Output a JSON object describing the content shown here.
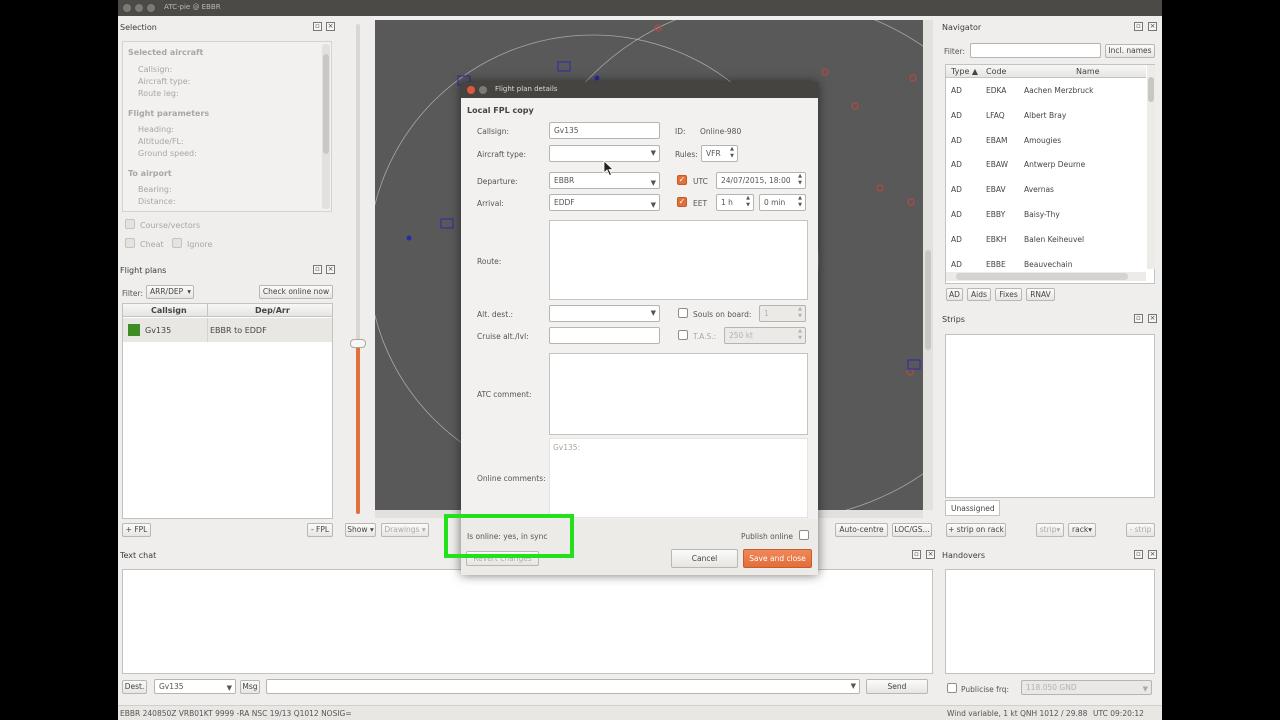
{
  "window": {
    "title": "ATC-pie @ EBBR"
  },
  "selection": {
    "title": "Selection",
    "selected_aircraft": "Selected aircraft",
    "callsign": "Callsign:",
    "aircraft_type": "Aircraft type:",
    "route_leg": "Route leg:",
    "flight_parameters": "Flight parameters",
    "heading": "Heading:",
    "altitude": "Altitude/FL:",
    "ground_speed": "Ground speed:",
    "to_airport": "To airport",
    "bearing": "Bearing:",
    "distance": "Distance:",
    "course_vectors": "Course/vectors",
    "cheat": "Cheat",
    "ignore": "Ignore"
  },
  "flight_plans": {
    "title": "Flight plans",
    "filter_label": "Filter:",
    "filter_value": "ARR/DEP",
    "check_online": "Check online now",
    "col_callsign": "Callsign",
    "col_deparr": "Dep/Arr",
    "rows": [
      {
        "callsign": "Gv135",
        "deparr": "EBBR to EDDF",
        "color": "#3f8b25"
      }
    ],
    "add_fpl": "+ FPL",
    "remove_fpl": "- FPL"
  },
  "radar_toolbar": {
    "show": "Show",
    "drawings": "Drawings",
    "auto_centre": "Auto-centre",
    "loc_gs": "LOC/GS..."
  },
  "navigator": {
    "title": "Navigator",
    "filter_label": "Filter:",
    "incl_names": "Incl. names",
    "col_type": "Type",
    "col_code": "Code",
    "col_name": "Name",
    "rows": [
      {
        "type": "AD",
        "code": "EDKA",
        "name": "Aachen Merzbruck"
      },
      {
        "type": "AD",
        "code": "LFAQ",
        "name": "Albert Bray"
      },
      {
        "type": "AD",
        "code": "EBAM",
        "name": "Amougies"
      },
      {
        "type": "AD",
        "code": "EBAW",
        "name": "Antwerp Deurne"
      },
      {
        "type": "AD",
        "code": "EBAV",
        "name": "Avernas"
      },
      {
        "type": "AD",
        "code": "EBBY",
        "name": "Baisy-Thy"
      },
      {
        "type": "AD",
        "code": "EBKH",
        "name": "Balen Keiheuvel"
      },
      {
        "type": "AD",
        "code": "EBBE",
        "name": "Beauvechain"
      }
    ],
    "tabs": [
      "AD",
      "Aids",
      "Fixes",
      "RNAV"
    ]
  },
  "strips": {
    "title": "Strips",
    "unassigned": "Unassigned",
    "strip_on_rack": "+ strip on rack",
    "strip": "strip",
    "rack": "rack",
    "remove_strip": "- strip"
  },
  "text_chat": {
    "title": "Text chat",
    "dest_label": "Dest.",
    "dest_value": "Gv135",
    "msg_label": "Msg",
    "send": "Send"
  },
  "handovers": {
    "title": "Handovers",
    "publicise_frq": "Publicise frq:",
    "frq_value": "118.050  GND"
  },
  "status_bar": {
    "metar": "EBBR 240850Z VRB01KT 9999 -RA NSC 19/13 Q1012 NOSIG=",
    "wind": "Wind variable, 1 kt",
    "qnh": "QNH 1012 / 29.88",
    "utc": "UTC 09:20:12"
  },
  "dialog": {
    "title": "Flight plan details",
    "section": "Local FPL copy",
    "callsign_label": "Callsign:",
    "callsign_value": "Gv135",
    "id_label": "ID:",
    "id_value": "Online-980",
    "aircraft_type_label": "Aircraft type:",
    "rules_label": "Rules:",
    "rules_value": "VFR",
    "departure_label": "Departure:",
    "departure_value": "EBBR",
    "utc_label": "UTC",
    "utc_value": "24/07/2015, 18:00",
    "arrival_label": "Arrival:",
    "arrival_value": "EDDF",
    "eet_label": "EET",
    "eet_hours": "1 h",
    "eet_minutes": "0 min",
    "route_label": "Route:",
    "alt_dest_label": "Alt. dest.:",
    "souls_label": "Souls on board:",
    "souls_value": "1",
    "cruise_label": "Cruise alt./lvl:",
    "tas_label": "T.A.S.:",
    "tas_value": "250 kt",
    "atc_comment_label": "ATC comment:",
    "online_comments_label": "Online comments:",
    "online_comments_value": "Gv135:",
    "is_online": "Is online: yes, in sync",
    "publish_online": "Publish online",
    "revert": "Revert changes",
    "cancel": "Cancel",
    "save": "Save and close"
  }
}
